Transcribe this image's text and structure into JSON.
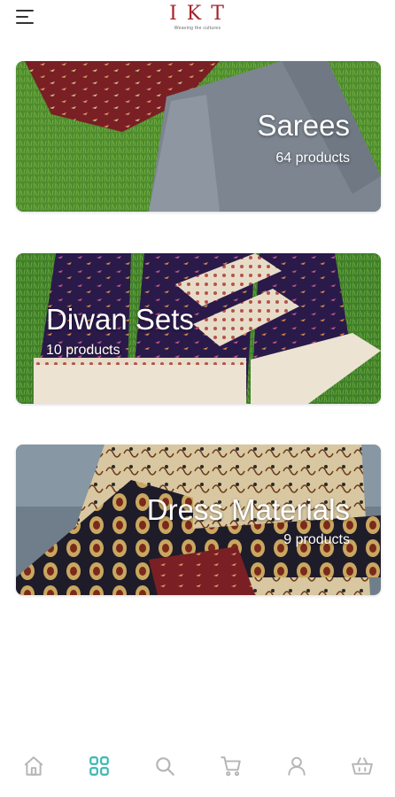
{
  "header": {
    "logo_text": "I K T",
    "tagline": "Weaving the cultures"
  },
  "categories": [
    {
      "name": "Sarees",
      "count": "64 products"
    },
    {
      "name": "Diwan Sets",
      "count": "10 products"
    },
    {
      "name": "Dress Materials",
      "count": "9 products"
    }
  ],
  "colors": {
    "brand": "#a3242a",
    "nav_active": "#3bb7b0",
    "nav_inactive": "#b5b5b5"
  },
  "bottom_nav": [
    {
      "icon": "home-icon",
      "active": false
    },
    {
      "icon": "categories-grid-icon",
      "active": true
    },
    {
      "icon": "search-icon",
      "active": false
    },
    {
      "icon": "cart-icon",
      "active": false
    },
    {
      "icon": "account-icon",
      "active": false
    },
    {
      "icon": "shopping-bag-icon",
      "active": false
    }
  ]
}
